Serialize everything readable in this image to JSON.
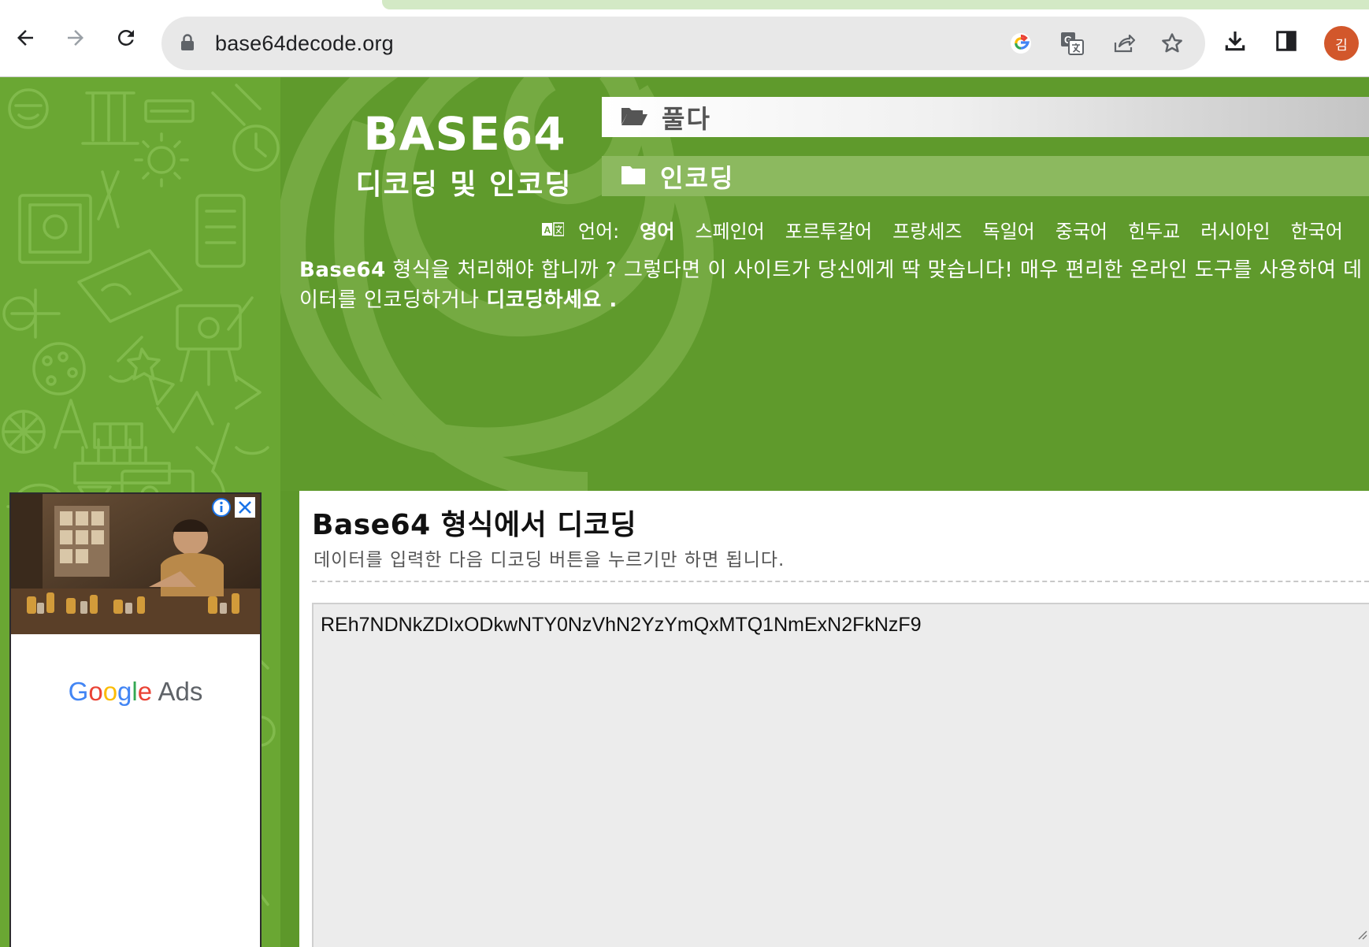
{
  "browser": {
    "url": "base64decode.org",
    "profile_initial": "김",
    "icons": [
      "back-icon",
      "forward-icon",
      "reload-icon",
      "lock-icon",
      "google-lens-icon",
      "translate-icon",
      "share-icon",
      "bookmark-star-icon",
      "download-icon",
      "side-panel-icon"
    ]
  },
  "site": {
    "logo_title": "BASE64",
    "logo_subtitle": "디코딩 및 인코딩",
    "menu": {
      "decode_label": "풀다",
      "encode_label": "인코딩"
    },
    "languages": {
      "label": "언어:",
      "items": [
        "영어",
        "스페인어",
        "포르투갈어",
        "프랑세즈",
        "독일어",
        "중국어",
        "힌두교",
        "러시아인",
        "한국어"
      ],
      "active": "영어"
    },
    "intro": {
      "part1": "Base64",
      "part2": " 형식을 처리해야 합니까 ? 그렇다면 이 사이트가 당신에게 딱 맞습니다! 매우 편리한 온라인 도구를 사용하여 데이터를 인코딩하거나 ",
      "part3": "디코딩하세요 ."
    }
  },
  "ad": {
    "brand_parts": [
      "G",
      "o",
      "o",
      "g",
      "l",
      "e"
    ],
    "brand_suffix": " Ads"
  },
  "card": {
    "title": "Base64 형식에서 디코딩",
    "description": "데이터를 입력한 다음 디코딩 버튼을 누르기만 하면 됩니다.",
    "input_value": "REh7NDNkZDIxODkwNTY0NzVhN2YzYmQxMTQ1NmExN2FkNzF9"
  },
  "colors": {
    "brand_green": "#5f9a2c",
    "pattern_green": "#6aa733",
    "avatar": "#d2572b"
  }
}
